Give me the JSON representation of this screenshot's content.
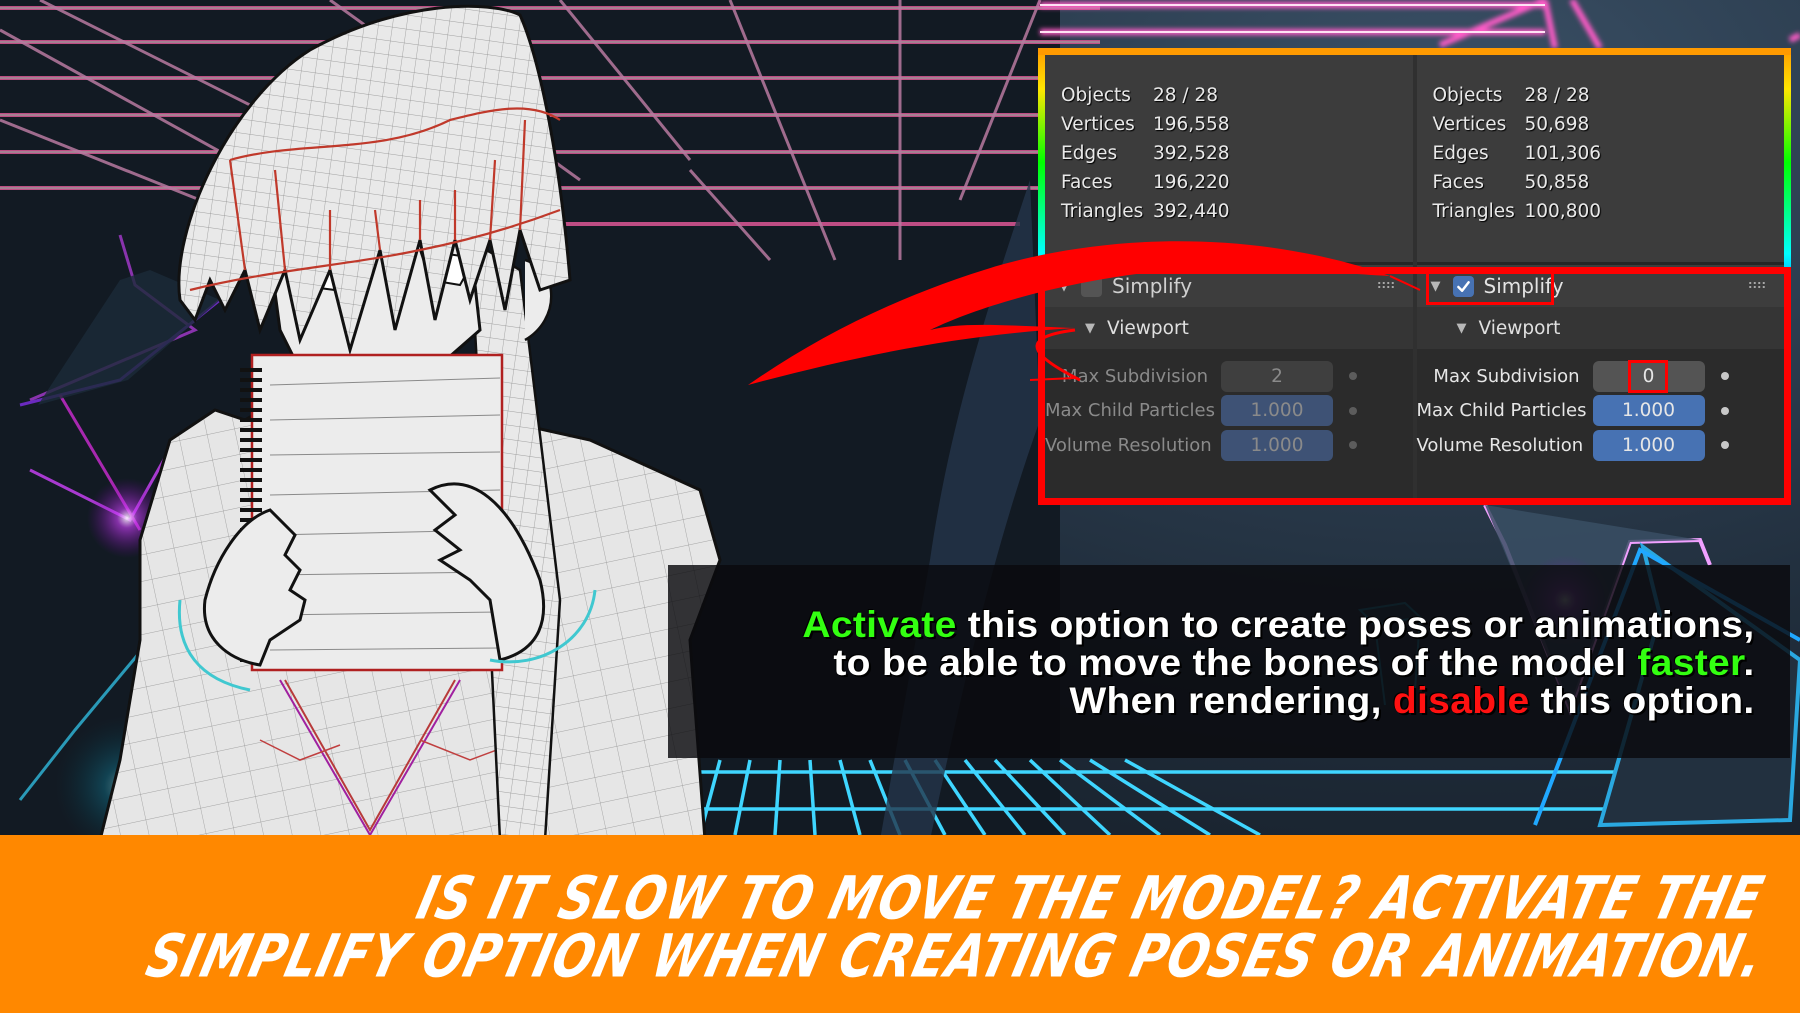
{
  "panel": {
    "left": {
      "state": "disabled",
      "stats": [
        {
          "label": "Objects",
          "value": "28 / 28"
        },
        {
          "label": "Vertices",
          "value": "196,558"
        },
        {
          "label": "Edges",
          "value": "392,528"
        },
        {
          "label": "Faces",
          "value": "196,220"
        },
        {
          "label": "Triangles",
          "value": "392,440"
        }
      ],
      "section_title": "Simplify",
      "section_checked": false,
      "subsection_title": "Viewport",
      "properties": [
        {
          "label": "Max Subdivision",
          "value": "2"
        },
        {
          "label": "Max Child Particles",
          "value": "1.000"
        },
        {
          "label": "Volume Resolution",
          "value": "1.000"
        }
      ]
    },
    "right": {
      "state": "enabled",
      "stats": [
        {
          "label": "Objects",
          "value": "28 / 28"
        },
        {
          "label": "Vertices",
          "value": "50,698"
        },
        {
          "label": "Edges",
          "value": "101,306"
        },
        {
          "label": "Faces",
          "value": "50,858"
        },
        {
          "label": "Triangles",
          "value": "100,800"
        }
      ],
      "section_title": "Simplify",
      "section_checked": true,
      "subsection_title": "Viewport",
      "properties": [
        {
          "label": "Max Subdivision",
          "value": "0"
        },
        {
          "label": "Max Child Particles",
          "value": "1.000"
        },
        {
          "label": "Volume Resolution",
          "value": "1.000"
        }
      ]
    },
    "icons": {
      "collapse": "triangle-down-icon",
      "checkbox": "checkbox-icon",
      "drag": "grip-dots-icon",
      "keyframe": "keyframe-dot-icon"
    }
  },
  "callout": {
    "line1": {
      "highlight": "Activate",
      "rest": " this option to create poses or animations,"
    },
    "line2": {
      "before": "to be able to move the bones of the model ",
      "highlight": "faster",
      "after": "."
    },
    "line3": {
      "before": "When rendering, ",
      "highlight": "disable",
      "after": " this option."
    }
  },
  "banner": {
    "line1": "Is it slow to move the model? Activate the",
    "line2": "Simplify option when creating poses or animation."
  },
  "colors": {
    "banner_bg": "#ff8800",
    "accent_green": "#33ff11",
    "accent_red": "#ff1111",
    "blender_blue": "#4772b3",
    "panel_bg": "#303030"
  }
}
